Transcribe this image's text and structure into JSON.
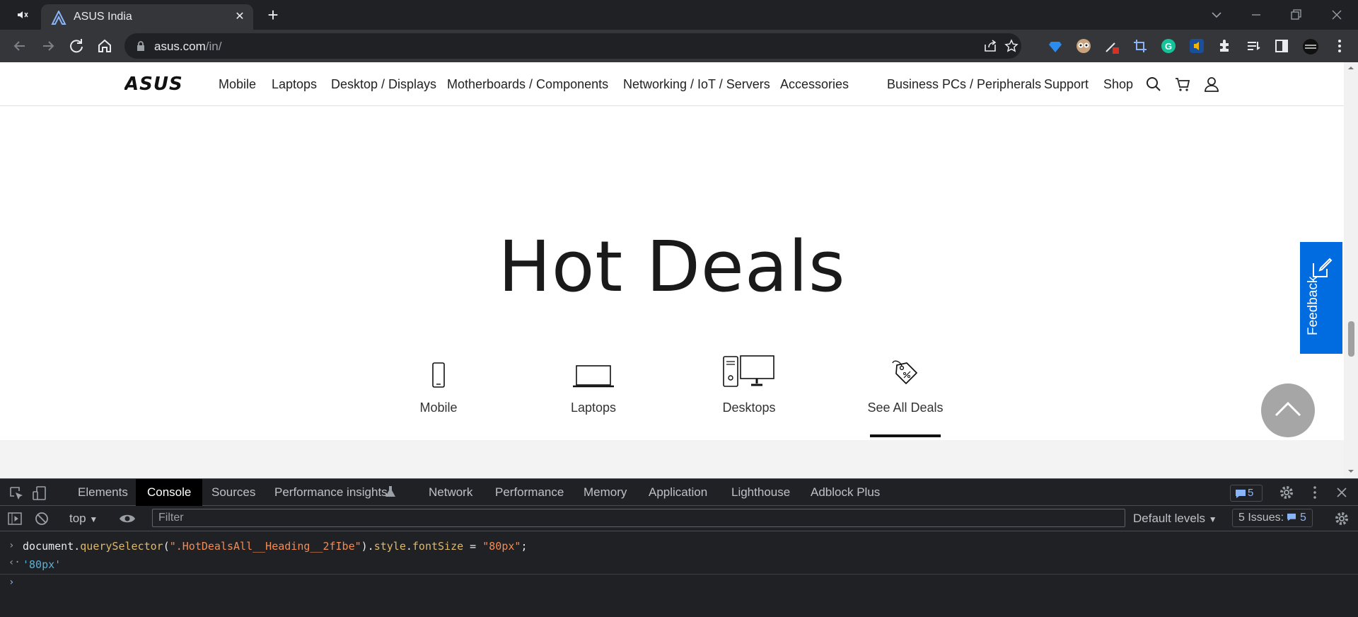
{
  "browser": {
    "tab_title": "ASUS India",
    "tab_close": "✕",
    "new_tab": "+",
    "url_host": "asus.com",
    "url_path": "/in/"
  },
  "site_nav": {
    "logo": "ASUS",
    "items": [
      "Mobile",
      "Laptops",
      "Desktop / Displays",
      "Motherboards / Components",
      "Networking / IoT / Servers",
      "Accessories",
      "Business PCs / Peripherals",
      "Support",
      "Shop"
    ]
  },
  "hot_deals": {
    "heading": "Hot Deals",
    "categories": [
      "Mobile",
      "Laptops",
      "Desktops",
      "See All Deals"
    ],
    "active_index": 3
  },
  "feedback": {
    "label": "Feedback"
  },
  "devtools": {
    "tabs": [
      "Elements",
      "Console",
      "Sources",
      "Performance insights",
      "Network",
      "Performance",
      "Memory",
      "Application",
      "Lighthouse",
      "Adblock Plus"
    ],
    "active_tab": "Console",
    "issues_count": "5",
    "context": "top",
    "filter_placeholder": "Filter",
    "levels": "Default levels",
    "issues_label": "5 Issues:",
    "issues_count_2": "5",
    "console_lines": {
      "cmd_prefix": "document.",
      "cmd_fn": "querySelector",
      "cmd_open": "(",
      "cmd_arg": "\".HotDealsAll__Heading__2fIbe\"",
      "cmd_mid": ").",
      "cmd_prop": "style",
      "cmd_dot": ".",
      "cmd_prop2": "fontSize",
      "cmd_eq": " = ",
      "cmd_value": "\"80px\"",
      "cmd_end": ";",
      "result": "'80px'"
    }
  },
  "colors": {
    "accent": "#006ce0",
    "devtools_bg": "#202124",
    "chrome_bg": "#35363a"
  }
}
